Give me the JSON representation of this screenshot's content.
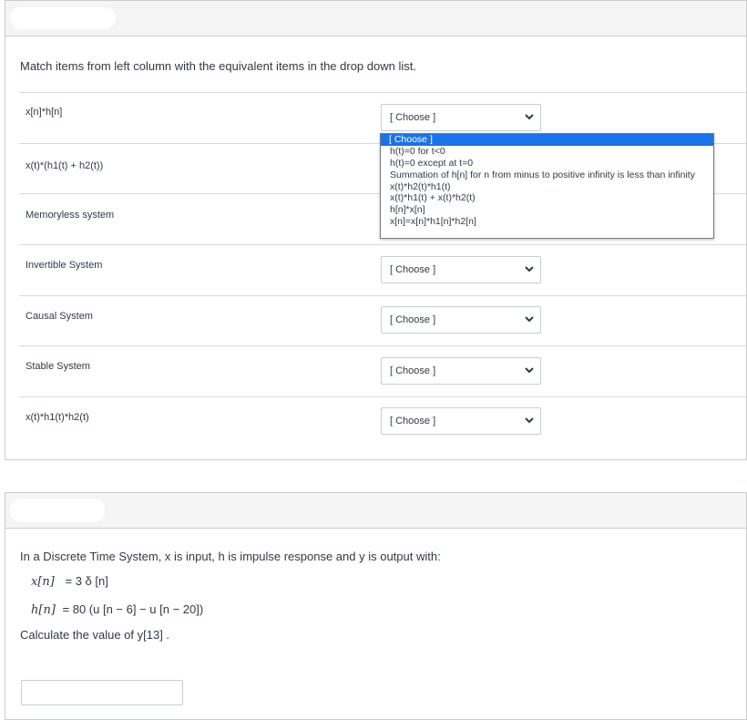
{
  "question1": {
    "instruction": "Match items from left column with the equivalent items in the drop down list.",
    "rows": [
      {
        "left": "x[n]*h[n]",
        "selected": "[ Choose ]"
      },
      {
        "left": "x(t)*(h1(t) + h2(t))",
        "selected": "[ Choose ]"
      },
      {
        "left": "Memoryless system",
        "selected": "[ Choose ]"
      },
      {
        "left": "Invertible System",
        "selected": "[ Choose ]"
      },
      {
        "left": "Causal System",
        "selected": "[ Choose ]"
      },
      {
        "left": "Stable System",
        "selected": "[ Choose ]"
      },
      {
        "left": "x(t)*h1(t)*h2(t)",
        "selected": "[ Choose ]"
      }
    ],
    "dropdown_options": [
      "[ Choose ]",
      "h(t)=0 for t<0",
      "h(t)=0 except at t=0",
      "Summation of h[n] for n from minus to positive infinity is less than infinity",
      "x(t)*h2(t)*h1(t)",
      "x(t)*h1(t) + x(t)*h2(t)",
      "h[n]*x[n]",
      "x[n]=x[n]*h1[n]*h2[n]"
    ]
  },
  "question2": {
    "intro": "In a Discrete Time System, x is input, h is impulse response and y is output with:",
    "eq1_lhs": "x[n]",
    "eq1_rhs": "= 3 δ [n]",
    "eq2_lhs": "h[n]",
    "eq2_rhs": "= 80 (u [n − 6] − u [n − 20])",
    "prompt": "Calculate the value of y[13] .",
    "answer_value": ""
  }
}
